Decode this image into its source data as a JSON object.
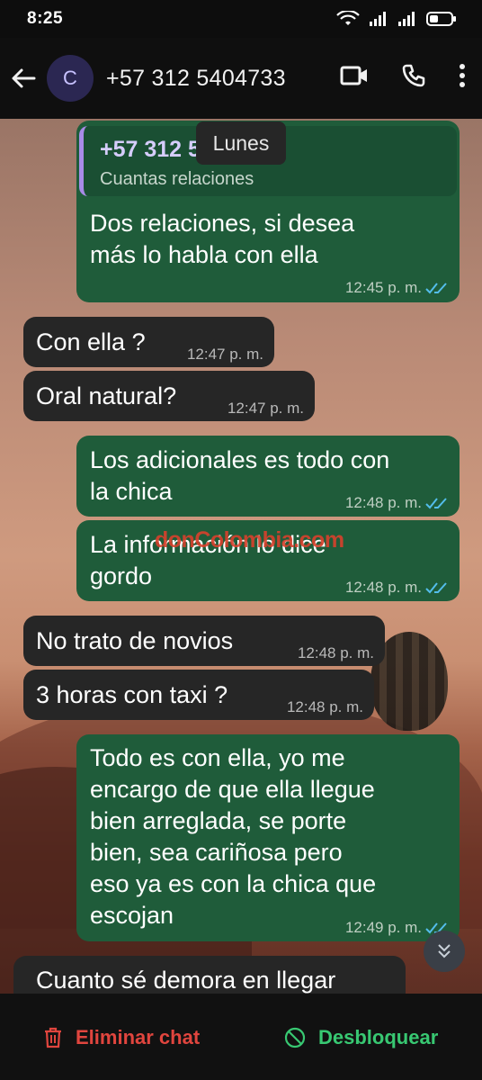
{
  "status_bar": {
    "time": "8:25"
  },
  "header": {
    "avatar_letter": "C",
    "contact": "+57 312 5404733"
  },
  "date_chip": "Lunes",
  "quoted": {
    "name": "+57 312 5404733",
    "text": "Cuantas relaciones"
  },
  "messages": [
    {
      "dir": "out",
      "text_lines": [
        "Dos relaciones, si desea",
        "más lo habla con ella"
      ],
      "time": "12:45 p. m."
    },
    {
      "dir": "in",
      "text": "Con ella ?",
      "time": "12:47 p. m."
    },
    {
      "dir": "in",
      "text": "Oral natural?",
      "time": "12:47 p. m."
    },
    {
      "dir": "out",
      "text_lines": [
        "Los adicionales es todo con",
        "la chica"
      ],
      "time": "12:48 p. m."
    },
    {
      "dir": "out",
      "text_lines": [
        "La información lo dice",
        "gordo"
      ],
      "time": "12:48 p. m."
    },
    {
      "dir": "in",
      "text": "No trato de novios",
      "time": "12:48 p. m."
    },
    {
      "dir": "in",
      "text": "3 horas con taxi ?",
      "time": "12:48 p. m."
    },
    {
      "dir": "out",
      "text_lines": [
        "Todo es con ella, yo me",
        "encargo de que ella llegue",
        "bien arreglada, se porte",
        "bien, sea cariñosa pero",
        "eso ya es con la chica que",
        "escojan"
      ],
      "time": "12:49 p. m."
    },
    {
      "dir": "in",
      "text": "Cuanto sé demora en llegar",
      "time": ""
    }
  ],
  "watermark": "donColombia.com",
  "bottom_bar": {
    "delete_label": "Eliminar chat",
    "unblock_label": "Desbloquear"
  },
  "colors": {
    "outgoing": "#1f5c3a",
    "incoming": "#262626",
    "delete": "#e0453e",
    "unblock": "#38c872",
    "read_ticks": "#53bdeb"
  }
}
